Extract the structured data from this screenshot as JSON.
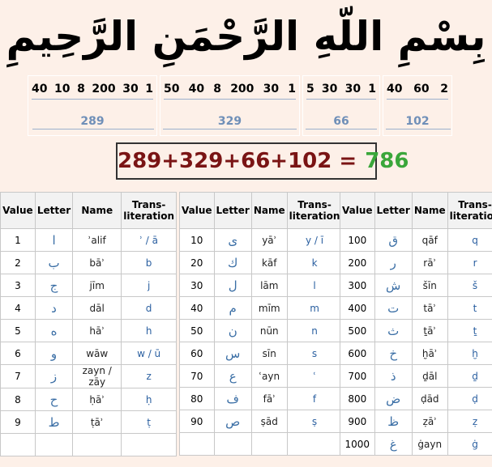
{
  "basmala": "بِسْمِ اللّهِ الرَّحْمَنِ الرَّحِيمِ",
  "words": [
    {
      "values": [
        "40",
        "10",
        "8",
        "200",
        "30",
        "1"
      ],
      "sum": "289"
    },
    {
      "values": [
        "50",
        "40",
        "8",
        "200",
        "30",
        "1"
      ],
      "sum": "329"
    },
    {
      "values": [
        "5",
        "30",
        "30",
        "1"
      ],
      "sum": "66"
    },
    {
      "values": [
        "40",
        "60",
        "2"
      ],
      "sum": "102"
    }
  ],
  "equation": {
    "expression": "289+329+66+102 =",
    "result": "786"
  },
  "table_headers": {
    "value": "Value",
    "letter": "Letter",
    "name": "Name",
    "translit_1": "Trans-",
    "translit_2": "literation"
  },
  "tables": [
    [
      {
        "value": "1",
        "letter": "ا",
        "name": "ʾalif",
        "translit": "ʾ / ā"
      },
      {
        "value": "2",
        "letter": "ب",
        "name": "bāʾ",
        "translit": "b"
      },
      {
        "value": "3",
        "letter": "ج",
        "name": "jīm",
        "translit": "j"
      },
      {
        "value": "4",
        "letter": "د",
        "name": "dāl",
        "translit": "d"
      },
      {
        "value": "5",
        "letter": "ه",
        "name": "hāʾ",
        "translit": "h"
      },
      {
        "value": "6",
        "letter": "و",
        "name": "wāw",
        "translit": "w / ū"
      },
      {
        "value": "7",
        "letter": "ز",
        "name": "zayn / zāy",
        "translit": "z"
      },
      {
        "value": "8",
        "letter": "ح",
        "name": "ḥāʾ",
        "translit": "ḥ"
      },
      {
        "value": "9",
        "letter": "ط",
        "name": "ṭāʾ",
        "translit": "ṭ"
      },
      {
        "value": "",
        "letter": "",
        "name": "",
        "translit": ""
      }
    ],
    [
      {
        "value": "10",
        "letter": "ى",
        "name": "yāʾ",
        "translit": "y / ī"
      },
      {
        "value": "20",
        "letter": "ك",
        "name": "kāf",
        "translit": "k"
      },
      {
        "value": "30",
        "letter": "ل",
        "name": "lām",
        "translit": "l"
      },
      {
        "value": "40",
        "letter": "م",
        "name": "mīm",
        "translit": "m"
      },
      {
        "value": "50",
        "letter": "ن",
        "name": "nūn",
        "translit": "n"
      },
      {
        "value": "60",
        "letter": "س",
        "name": "sīn",
        "translit": "s"
      },
      {
        "value": "70",
        "letter": "ع",
        "name": "ʿayn",
        "translit": "ʿ"
      },
      {
        "value": "80",
        "letter": "ف",
        "name": "fāʾ",
        "translit": "f"
      },
      {
        "value": "90",
        "letter": "ص",
        "name": "ṣād",
        "translit": "ṣ"
      },
      {
        "value": "",
        "letter": "",
        "name": "",
        "translit": ""
      }
    ],
    [
      {
        "value": "100",
        "letter": "ق",
        "name": "qāf",
        "translit": "q"
      },
      {
        "value": "200",
        "letter": "ر",
        "name": "rāʾ",
        "translit": "r"
      },
      {
        "value": "300",
        "letter": "ش",
        "name": "šīn",
        "translit": "š"
      },
      {
        "value": "400",
        "letter": "ت",
        "name": "tāʾ",
        "translit": "t"
      },
      {
        "value": "500",
        "letter": "ث",
        "name": "ṯāʾ",
        "translit": "ṯ"
      },
      {
        "value": "600",
        "letter": "خ",
        "name": "ḫāʾ",
        "translit": "ḫ"
      },
      {
        "value": "700",
        "letter": "ذ",
        "name": "ḏāl",
        "translit": "ḏ"
      },
      {
        "value": "800",
        "letter": "ض",
        "name": "ḍād",
        "translit": "ḍ"
      },
      {
        "value": "900",
        "letter": "ظ",
        "name": "ẓāʾ",
        "translit": "ẓ"
      },
      {
        "value": "1000",
        "letter": "غ",
        "name": "ġayn",
        "translit": "ġ"
      }
    ]
  ]
}
